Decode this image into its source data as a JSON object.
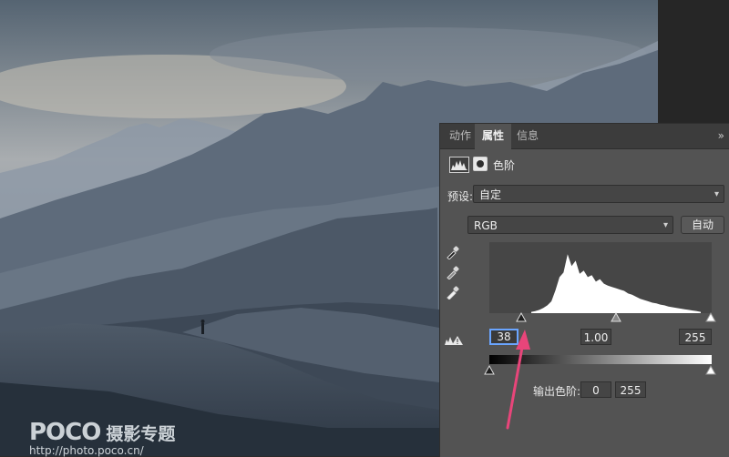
{
  "watermark": {
    "logo": "POCO",
    "subtitle": "摄影专题",
    "url": "http://photo.poco.cn/"
  },
  "panel": {
    "tabs": [
      {
        "label": "动作",
        "active": false
      },
      {
        "label": "属性",
        "active": true
      },
      {
        "label": "信息",
        "active": false
      }
    ],
    "collapse_label": "»",
    "header_title": "色阶",
    "preset_label": "预设:",
    "preset_value": "自定",
    "channel_value": "RGB",
    "auto_label": "自动",
    "input_black": "38",
    "input_gamma": "1.00",
    "input_white": "255",
    "output_label": "输出色阶:",
    "output_black": "0",
    "output_white": "255"
  },
  "histogram": {
    "bins_start": 38,
    "bins_end": 255,
    "levels": [
      0.02,
      0.03,
      0.05,
      0.08,
      0.12,
      0.18,
      0.35,
      0.55,
      0.62,
      0.9,
      0.72,
      0.8,
      0.6,
      0.65,
      0.55,
      0.58,
      0.48,
      0.52,
      0.45,
      0.42,
      0.4,
      0.38,
      0.36,
      0.34,
      0.3,
      0.28,
      0.25,
      0.22,
      0.2,
      0.18,
      0.16,
      0.15,
      0.13,
      0.12,
      0.1,
      0.09,
      0.08,
      0.07,
      0.06,
      0.05,
      0.04,
      0.03,
      0.02
    ]
  },
  "colors": {
    "accent": "#6aa5ff",
    "annotation_arrow": "#e8457a"
  }
}
